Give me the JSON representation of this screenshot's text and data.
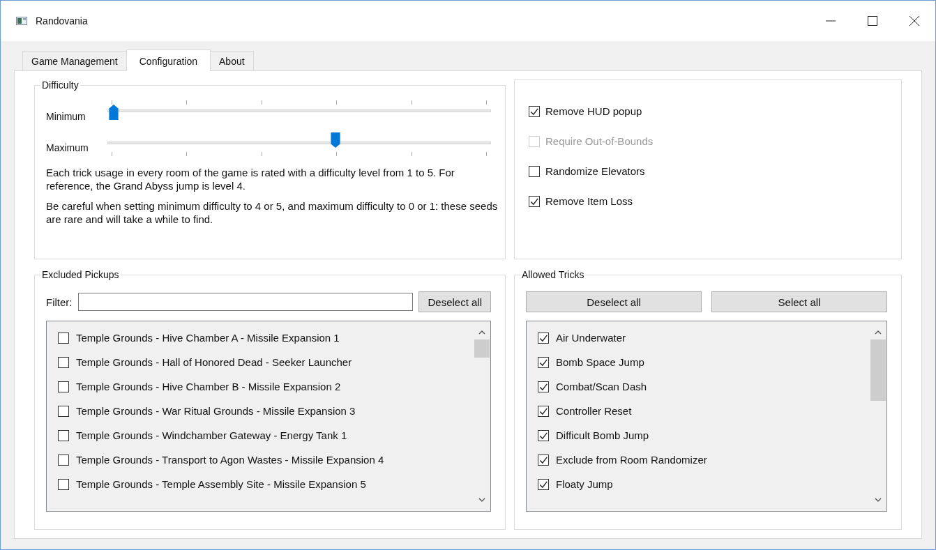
{
  "window": {
    "title": "Randovania"
  },
  "tabs": [
    {
      "label": "Game Management",
      "selected": false
    },
    {
      "label": "Configuration",
      "selected": true
    },
    {
      "label": "About",
      "selected": false
    }
  ],
  "difficulty": {
    "title": "Difficulty",
    "sliders": [
      {
        "label": "Minimum",
        "level": 0
      },
      {
        "label": "Maximum",
        "level": 0.6
      }
    ],
    "paragraphs": [
      "Each trick usage in every room of the game is rated with a difficulty level from 1 to 5. For reference, the Grand Abyss jump is level 4.",
      "Be careful when setting minimum difficulty to 4 or 5, and maximum difficulty to 0 or 1: these seeds are rare and will take a while to find."
    ]
  },
  "options": [
    {
      "label": "Remove HUD popup",
      "checked": true,
      "disabled": false
    },
    {
      "label": "Require Out-of-Bounds",
      "checked": false,
      "disabled": true
    },
    {
      "label": "Randomize Elevators",
      "checked": false,
      "disabled": false
    },
    {
      "label": "Remove Item Loss",
      "checked": true,
      "disabled": false
    }
  ],
  "excluded_pickups": {
    "title": "Excluded Pickups",
    "filter_label": "Filter:",
    "button": "Deselect all",
    "items": [
      {
        "label": "Temple Grounds - Hive Chamber A - Missile Expansion 1",
        "checked": false
      },
      {
        "label": "Temple Grounds - Hall of Honored Dead - Seeker Launcher",
        "checked": false
      },
      {
        "label": "Temple Grounds - Hive Chamber B - Missile Expansion 2",
        "checked": false
      },
      {
        "label": "Temple Grounds - War Ritual Grounds - Missile Expansion 3",
        "checked": false
      },
      {
        "label": "Temple Grounds - Windchamber Gateway - Energy Tank 1",
        "checked": false
      },
      {
        "label": "Temple Grounds - Transport to Agon Wastes - Missile Expansion 4",
        "checked": false
      },
      {
        "label": "Temple Grounds - Temple Assembly Site - Missile Expansion 5",
        "checked": false
      }
    ]
  },
  "allowed_tricks": {
    "title": "Allowed Tricks",
    "buttons": [
      "Deselect all",
      "Select all"
    ],
    "items": [
      {
        "label": "Air Underwater",
        "checked": true
      },
      {
        "label": "Bomb Space Jump",
        "checked": true
      },
      {
        "label": "Combat/Scan Dash",
        "checked": true
      },
      {
        "label": "Controller Reset",
        "checked": true
      },
      {
        "label": "Difficult Bomb Jump",
        "checked": true
      },
      {
        "label": "Exclude from Room Randomizer",
        "checked": true
      },
      {
        "label": "Floaty Jump",
        "checked": true
      }
    ]
  }
}
